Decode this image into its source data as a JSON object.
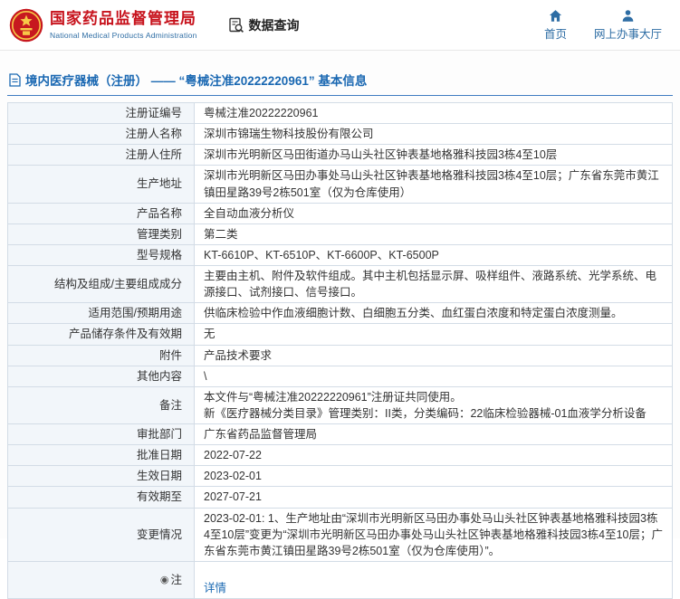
{
  "header": {
    "brand": {
      "name_cn": "国家药品监督管理局",
      "name_en": "National Medical Products Administration"
    },
    "data_query_label": "数据查询",
    "nav": {
      "home": "首页",
      "service_hall": "网上办事大厅"
    },
    "colors": {
      "brand_red": "#c7131d",
      "link_blue": "#2e6da4"
    }
  },
  "title_bar": {
    "title": "境内医疗器械（注册） —— “粤械注准20222220961” 基本信息"
  },
  "table": {
    "rows": [
      {
        "label": "注册证编号",
        "value": "粤械注准20222220961"
      },
      {
        "label": "注册人名称",
        "value": "深圳市锦瑞生物科技股份有限公司"
      },
      {
        "label": "注册人住所",
        "value": "深圳市光明新区马田街道办马山头社区钟表基地格雅科技园3栋4至10层"
      },
      {
        "label": "生产地址",
        "value": "深圳市光明新区马田办事处马山头社区钟表基地格雅科技园3栋4至10层；广东省东莞市黄江镇田星路39号2栋501室（仅为仓库使用）"
      },
      {
        "label": "产品名称",
        "value": "全自动血液分析仪"
      },
      {
        "label": "管理类别",
        "value": "第二类"
      },
      {
        "label": "型号规格",
        "value": "KT-6610P、KT-6510P、KT-6600P、KT-6500P"
      },
      {
        "label": "结构及组成/主要组成成分",
        "value": "主要由主机、附件及软件组成。其中主机包括显示屏、吸样组件、液路系统、光学系统、电源接口、试剂接口、信号接口。"
      },
      {
        "label": "适用范围/预期用途",
        "value": "供临床检验中作血液细胞计数、白细胞五分类、血红蛋白浓度和特定蛋白浓度测量。"
      },
      {
        "label": "产品储存条件及有效期",
        "value": "无"
      },
      {
        "label": "附件",
        "value": "产品技术要求"
      },
      {
        "label": "其他内容",
        "value": "\\"
      },
      {
        "label": "备注",
        "value": "本文件与“粤械注准20222220961”注册证共同使用。\n新《医疗器械分类目录》管理类别：II类，分类编码：22临床检验器械-01血液学分析设备"
      },
      {
        "label": "审批部门",
        "value": "广东省药品监督管理局"
      },
      {
        "label": "批准日期",
        "value": "2022-07-22"
      },
      {
        "label": "生效日期",
        "value": "2023-02-01"
      },
      {
        "label": "有效期至",
        "value": "2027-07-21"
      },
      {
        "label": "变更情况",
        "value": "2023-02-01: 1、生产地址由“深圳市光明新区马田办事处马山头社区钟表基地格雅科技园3栋4至10层”变更为“深圳市光明新区马田办事处马山头社区钟表基地格雅科技园3栋4至10层；广东省东莞市黄江镇田星路39号2栋501室（仅为仓库使用）”。"
      },
      {
        "label": "注",
        "value": "详情"
      }
    ]
  }
}
